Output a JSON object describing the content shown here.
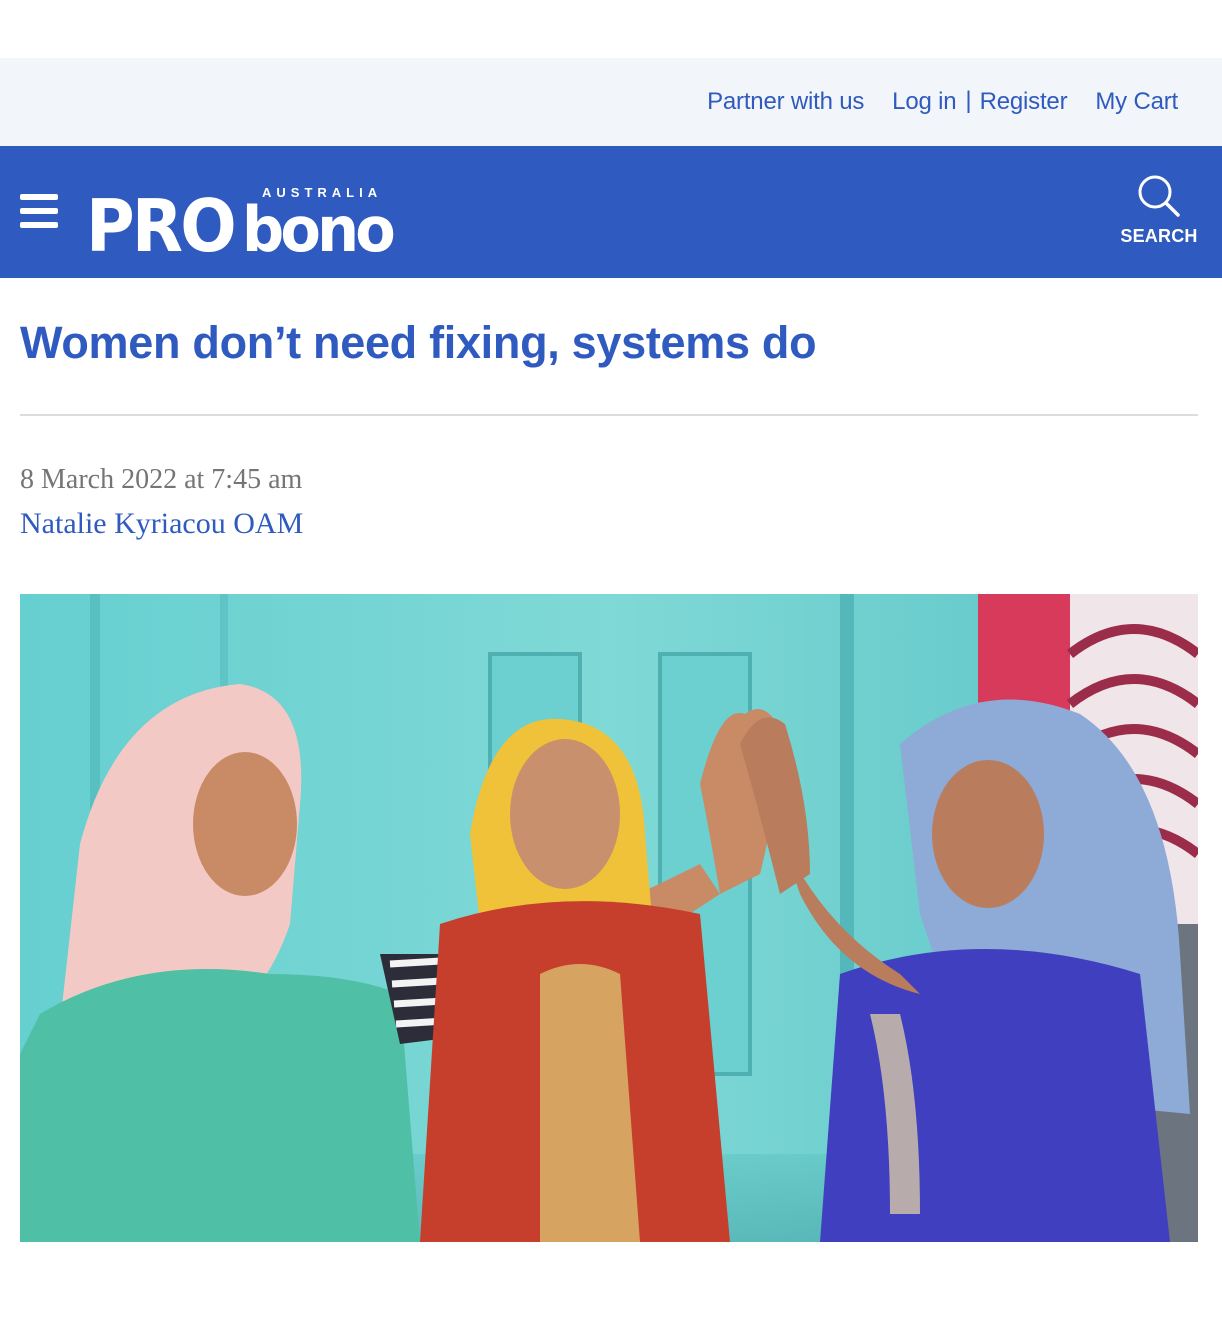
{
  "utility_nav": {
    "partner_label": "Partner with us",
    "login_label": "Log in",
    "separator": "|",
    "register_label": "Register",
    "cart_label": "My Cart"
  },
  "header": {
    "menu_icon": "hamburger-menu-icon",
    "logo": {
      "tagline": "AUSTRALIA",
      "word_pro": "PRO",
      "word_bono": "bono"
    },
    "search_icon": "search-icon",
    "search_label": "SEARCH"
  },
  "article": {
    "title": "Women don’t need fixing, systems do",
    "date": "8 March 2022 at 7:45 am",
    "author": "Natalie Kyriacou OAM"
  },
  "colors": {
    "brand_blue": "#2f5abf",
    "utility_bg": "#f2f5f9",
    "meta_gray": "#757575",
    "divider": "#dcdcdc"
  }
}
